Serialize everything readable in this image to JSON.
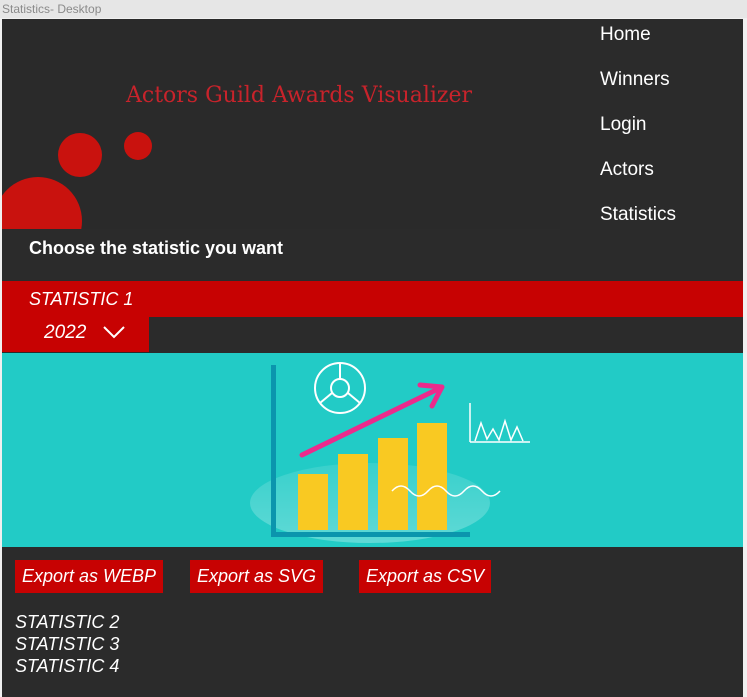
{
  "window": {
    "title": "Statistics- Desktop"
  },
  "header": {
    "title": "Actors Guild Awards Visualizer"
  },
  "nav": {
    "items": [
      {
        "label": "Home"
      },
      {
        "label": "Winners"
      },
      {
        "label": "Login"
      },
      {
        "label": "Actors"
      },
      {
        "label": "Statistics"
      }
    ]
  },
  "main": {
    "prompt": "Choose the statistic you want",
    "active_statistic": "STATISTIC 1",
    "year": "2022",
    "export_buttons": [
      "Export as WEBP",
      "Export as SVG",
      "Export as CSV"
    ],
    "other_statistics": [
      "STATISTIC 2",
      "STATISTIC 3",
      "STATISTIC 4"
    ]
  },
  "colors": {
    "accent": "#c70202",
    "title_red": "#c8232b",
    "background": "#2b2b2b",
    "illustration_bg": "#22cbc6",
    "bar_yellow": "#f9c922",
    "arrow_pink": "#ec2a8c"
  },
  "icons": {
    "year_dropdown": "chevron-down-icon",
    "illustration": "growth-chart-illustration"
  }
}
